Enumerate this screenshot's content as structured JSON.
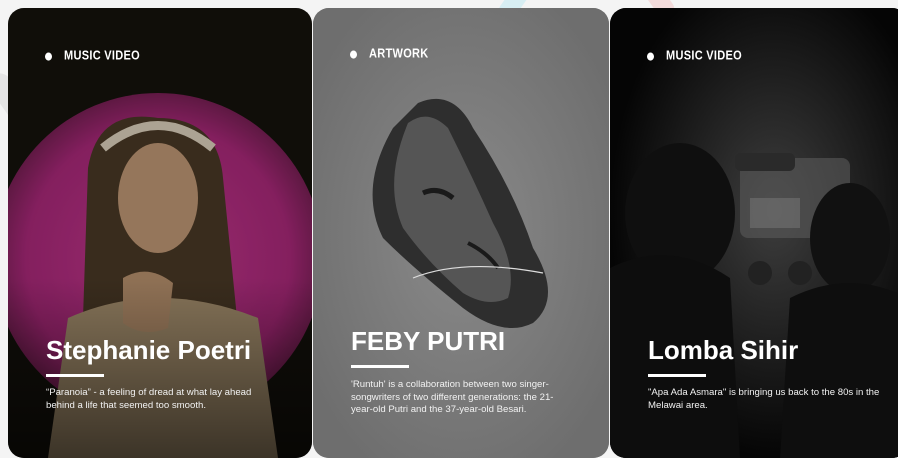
{
  "cards": [
    {
      "category": "MUSIC VIDEO",
      "title": "Stephanie Poetri",
      "description": "“Paranoia” - a feeling of dread at what lay ahead behind a life that seemed too smooth."
    },
    {
      "category": "ARTWORK",
      "title": "FEBY PUTRI",
      "description": "'Runtuh' is a collaboration between two singer-songwriters of two different generations: the 21-year-old Putri and the 37-year-old Besari."
    },
    {
      "category": "MUSIC VIDEO",
      "title": "Lomba Sihir",
      "description": "\"Apa Ada Asmara\" is bringing us back to the 80s in the Melawai area."
    }
  ],
  "colors": {
    "accent_magenta": "#a31a7a",
    "card_grey": "#7d7d7d",
    "text": "#ffffff"
  }
}
